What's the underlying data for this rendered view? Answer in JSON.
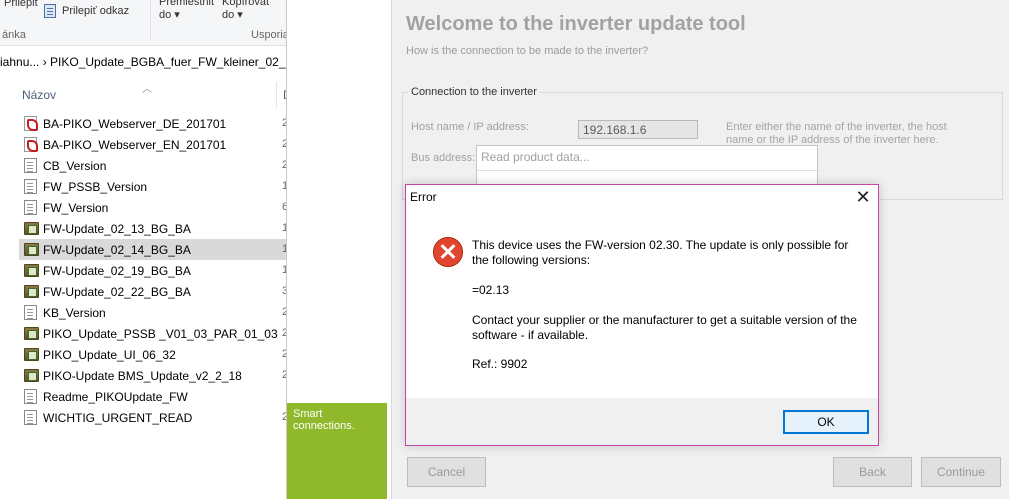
{
  "explorer": {
    "ribbon": {
      "paste": "Prilepiť",
      "paste_link": "Prilepiť odkaz",
      "move_to": "Premiestniť\ndo ▾",
      "copy_to": "Kopírovať\ndo ▾",
      "clipboard_group": "ánka",
      "organize_group": "Usporia"
    },
    "address": "iahnu... › PIKO_Update_BGBA_fuer_FW_kleiner_02_16",
    "column_name": "Názov",
    "column_next": "D",
    "files": [
      {
        "name": "BA-PIKO_Webserver_DE_201701",
        "icon": "pdf-icon",
        "cut": "2"
      },
      {
        "name": "BA-PIKO_Webserver_EN_201701",
        "icon": "pdf-icon",
        "cut": "2"
      },
      {
        "name": "CB_Version",
        "icon": "text-file-icon",
        "cut": "2"
      },
      {
        "name": "FW_PSSB_Version",
        "icon": "text-file-icon",
        "cut": "1"
      },
      {
        "name": "FW_Version",
        "icon": "text-file-icon",
        "cut": "6"
      },
      {
        "name": "FW-Update_02_13_BG_BA",
        "icon": "archive-icon",
        "cut": "1"
      },
      {
        "name": "FW-Update_02_14_BG_BA",
        "icon": "archive-icon",
        "cut": "1",
        "selected": true
      },
      {
        "name": "FW-Update_02_19_BG_BA",
        "icon": "archive-icon",
        "cut": "1"
      },
      {
        "name": "FW-Update_02_22_BG_BA",
        "icon": "archive-icon",
        "cut": "3"
      },
      {
        "name": "KB_Version",
        "icon": "text-file-icon",
        "cut": "2"
      },
      {
        "name": "PIKO_Update_PSSB _V01_03_PAR_01_03",
        "icon": "archive-icon",
        "cut": "2"
      },
      {
        "name": "PIKO_Update_UI_06_32",
        "icon": "archive-icon",
        "cut": "2"
      },
      {
        "name": "PIKO-Update BMS_Update_v2_2_18",
        "icon": "archive-icon",
        "cut": "2"
      },
      {
        "name": "Readme_PIKOUpdate_FW",
        "icon": "text-file-icon",
        "cut": ""
      },
      {
        "name": "WICHTIG_URGENT_READ",
        "icon": "text-file-icon",
        "cut": "2"
      }
    ]
  },
  "installer": {
    "brand": "Smart\nconnections.",
    "title": "Welcome to the inverter update tool",
    "subtitle": "How is the connection to be made to the inverter?",
    "group_title": "Connection to the inverter",
    "host_label": "Host name / IP address:",
    "host_value": "192.168.1.6",
    "hint": "Enter either the name of the inverter, the host name or the IP address of the inverter here.",
    "bus_label": "Bus address:",
    "dropdown_text": "Read product data...",
    "cancel": "Cancel",
    "back": "Back",
    "continue": "Continue"
  },
  "dialog": {
    "title": "Error",
    "close": "✕",
    "line1": "This device uses the FW-version 02.30. The update is only possible for the following versions:",
    "line2": "=02.13",
    "line3": "Contact your supplier or the manufacturer to get a suitable version of the software - if available.",
    "line4": "Ref.: 9902",
    "ok": "OK"
  },
  "colors": {
    "brand_green": "#8fb92a",
    "dialog_border": "#c346a3",
    "error_red": "#e0462d",
    "ok_border": "#0078d7"
  }
}
